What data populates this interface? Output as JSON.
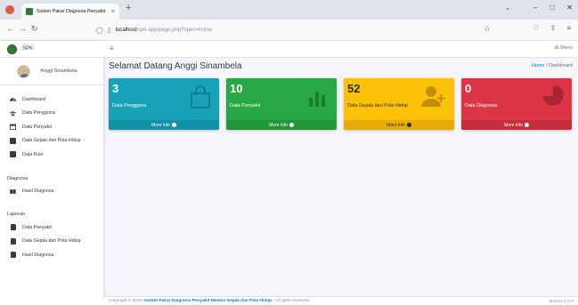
{
  "browser": {
    "tab_title": "Sistem Pakar Diagnosa Penyakit",
    "tab_close": "×",
    "new_tab": "+",
    "url_host": "localhost",
    "url_path": "/spk-app/page.php?open=home"
  },
  "brand": {
    "name": "SPK"
  },
  "user": {
    "name": "Anggi Sinambela"
  },
  "sidebar": {
    "items": [
      {
        "label": "Dashboard",
        "icon": "dashboard-icon"
      },
      {
        "label": "Data Pengguna",
        "icon": "users-icon"
      },
      {
        "label": "Data Penyakit",
        "icon": "calendar-icon"
      },
      {
        "label": "Data Gejala dan Pola Hidup",
        "icon": "list-icon"
      },
      {
        "label": "Data Rule",
        "icon": "clipboard-icon"
      }
    ],
    "diagnosa_header": "Diagnosa",
    "diagnosa_items": [
      {
        "label": "Hasil Diagnosa",
        "icon": "book-icon"
      }
    ],
    "laporan_header": "Laporan",
    "laporan_items": [
      {
        "label": "Data Penyakit",
        "icon": "file-icon"
      },
      {
        "label": "Data Gejala dan Pola Hidup",
        "icon": "file-icon"
      },
      {
        "label": "Hasil Diagnosa",
        "icon": "file-icon"
      }
    ]
  },
  "topbar": {
    "hamburger": "≡",
    "menu_label": "Menu"
  },
  "page": {
    "title": "Selamat Datang Anggi Sinambela",
    "breadcrumb_home": "Home",
    "breadcrumb_sep": " / ",
    "breadcrumb_current": "Dashboard"
  },
  "stats": [
    {
      "value": "3",
      "label": "Data Pengguna",
      "more": "More info",
      "color": "#17a2b8",
      "icon": "shopping-bag-icon"
    },
    {
      "value": "10",
      "label": "Data Penyakit",
      "more": "More info",
      "color": "#28a745",
      "icon": "bar-chart-icon"
    },
    {
      "value": "52",
      "label": "Data Gejala dan Pola Hidup",
      "more": "More info",
      "color": "#ffc107",
      "icon": "user-plus-icon"
    },
    {
      "value": "0",
      "label": "Data Diagnosa",
      "more": "More info",
      "color": "#dc3545",
      "icon": "pie-chart-icon"
    }
  ],
  "footer": {
    "prefix": "Copyright © 2022",
    "link": "Sistem Pakar Diagnosa Penyakit Melalui Gejala dan Pola Hidup.",
    "suffix": "All rights reserved.",
    "version": "Version 1.0.0"
  }
}
